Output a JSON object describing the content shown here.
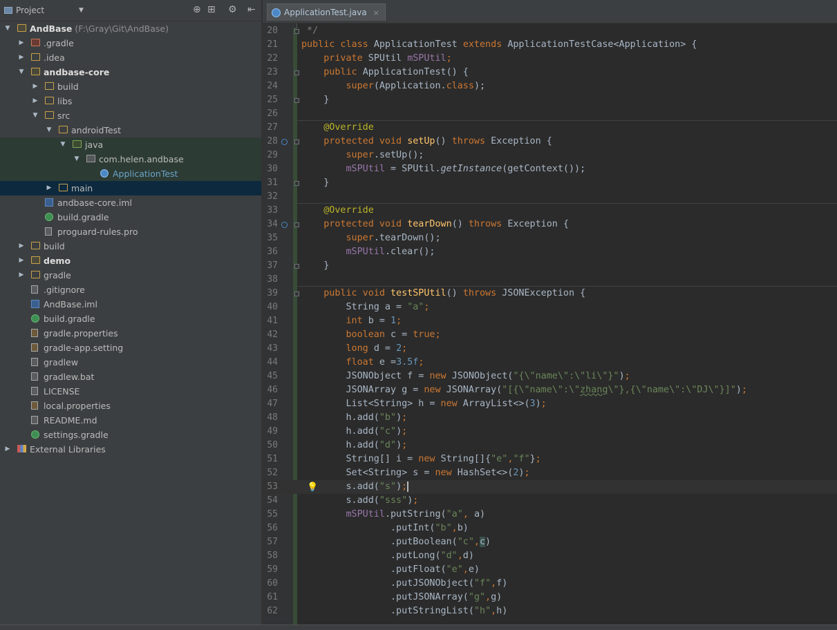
{
  "project_panel": {
    "title": "Project",
    "tree": [
      {
        "label": "AndBase",
        "path": "(F:\\Gray\\Git\\AndBase)",
        "depth": 0,
        "arrow": "open",
        "icon": "module-folder-icon",
        "bold": true
      },
      {
        "label": ".gradle",
        "depth": 1,
        "arrow": "closed",
        "icon": "folder-excluded-icon"
      },
      {
        "label": ".idea",
        "depth": 1,
        "arrow": "closed",
        "icon": "folder-icon"
      },
      {
        "label": "andbase-core",
        "depth": 1,
        "arrow": "open",
        "icon": "module-folder-icon",
        "bold": true
      },
      {
        "label": "build",
        "depth": 2,
        "arrow": "closed",
        "icon": "folder-icon"
      },
      {
        "label": "libs",
        "depth": 2,
        "arrow": "closed",
        "icon": "folder-icon"
      },
      {
        "label": "src",
        "depth": 2,
        "arrow": "open",
        "icon": "folder-icon"
      },
      {
        "label": "androidTest",
        "depth": 3,
        "arrow": "open",
        "icon": "folder-icon"
      },
      {
        "label": "java",
        "depth": 4,
        "arrow": "open",
        "icon": "test-source-folder-icon",
        "highlight": "soft"
      },
      {
        "label": "com.helen.andbase",
        "depth": 5,
        "arrow": "open",
        "icon": "package-icon",
        "highlight": "soft"
      },
      {
        "label": "ApplicationTest",
        "depth": 6,
        "arrow": "none",
        "icon": "java-class-icon",
        "teal": true,
        "highlight": "soft"
      },
      {
        "label": "main",
        "depth": 3,
        "arrow": "closed",
        "icon": "folder-icon",
        "highlight": "selected"
      },
      {
        "label": "andbase-core.iml",
        "depth": 2,
        "arrow": "none",
        "icon": "iml-file-icon"
      },
      {
        "label": "build.gradle",
        "depth": 2,
        "arrow": "none",
        "icon": "gradle-file-icon"
      },
      {
        "label": "proguard-rules.pro",
        "depth": 2,
        "arrow": "none",
        "icon": "file-icon"
      },
      {
        "label": "build",
        "depth": 1,
        "arrow": "closed",
        "icon": "folder-icon"
      },
      {
        "label": "demo",
        "depth": 1,
        "arrow": "closed",
        "icon": "module-folder-icon",
        "bold": true
      },
      {
        "label": "gradle",
        "depth": 1,
        "arrow": "closed",
        "icon": "folder-icon"
      },
      {
        "label": ".gitignore",
        "depth": 1,
        "arrow": "none",
        "icon": "file-icon"
      },
      {
        "label": "AndBase.iml",
        "depth": 1,
        "arrow": "none",
        "icon": "iml-file-icon"
      },
      {
        "label": "build.gradle",
        "depth": 1,
        "arrow": "none",
        "icon": "gradle-file-icon"
      },
      {
        "label": "gradle.properties",
        "depth": 1,
        "arrow": "none",
        "icon": "properties-file-icon"
      },
      {
        "label": "gradle-app.setting",
        "depth": 1,
        "arrow": "none",
        "icon": "properties-file-icon"
      },
      {
        "label": "gradlew",
        "depth": 1,
        "arrow": "none",
        "icon": "file-icon"
      },
      {
        "label": "gradlew.bat",
        "depth": 1,
        "arrow": "none",
        "icon": "file-icon"
      },
      {
        "label": "LICENSE",
        "depth": 1,
        "arrow": "none",
        "icon": "file-icon"
      },
      {
        "label": "local.properties",
        "depth": 1,
        "arrow": "none",
        "icon": "properties-file-icon"
      },
      {
        "label": "README.md",
        "depth": 1,
        "arrow": "none",
        "icon": "file-icon"
      },
      {
        "label": "settings.gradle",
        "depth": 1,
        "arrow": "none",
        "icon": "gradle-file-icon"
      },
      {
        "label": "External Libraries",
        "depth": 0,
        "arrow": "closed",
        "icon": "libraries-icon"
      }
    ]
  },
  "editor": {
    "tab": {
      "label": "ApplicationTest.java",
      "close": "×"
    },
    "lines": [
      {
        "n": "20",
        "t": [
          [
            "cm",
            " */"
          ]
        ]
      },
      {
        "n": "21",
        "t": [
          [
            "kw",
            "public class "
          ],
          [
            "",
            "ApplicationTest "
          ],
          [
            "kw",
            "extends "
          ],
          [
            "",
            "ApplicationTestCase<Application> {"
          ]
        ]
      },
      {
        "n": "22",
        "t": [
          [
            "",
            "    "
          ],
          [
            "kw",
            "private "
          ],
          [
            "",
            "SPUtil "
          ],
          [
            "fld",
            "mSPUtil"
          ],
          [
            "kw",
            ";"
          ]
        ]
      },
      {
        "n": "23",
        "t": [
          [
            "",
            "    "
          ],
          [
            "kw",
            "public "
          ],
          [
            "",
            "ApplicationTest() {"
          ]
        ]
      },
      {
        "n": "24",
        "t": [
          [
            "",
            "        "
          ],
          [
            "kw",
            "super"
          ],
          [
            "",
            "(Application."
          ],
          [
            "kw",
            "class"
          ],
          [
            "",
            ");"
          ]
        ]
      },
      {
        "n": "25",
        "t": [
          [
            "",
            "    }"
          ]
        ]
      },
      {
        "n": "26",
        "t": [
          [
            "",
            ""
          ]
        ]
      },
      {
        "n": "27",
        "t": [
          [
            "",
            "    "
          ],
          [
            "an",
            "@Override"
          ]
        ]
      },
      {
        "n": "28",
        "t": [
          [
            "",
            "    "
          ],
          [
            "kw",
            "protected void "
          ],
          [
            "fn",
            "setUp"
          ],
          [
            "",
            "() "
          ],
          [
            "kw",
            "throws "
          ],
          [
            "",
            "Exception {"
          ]
        ]
      },
      {
        "n": "29",
        "t": [
          [
            "",
            "        "
          ],
          [
            "kw",
            "super"
          ],
          [
            "",
            ".setUp();"
          ]
        ]
      },
      {
        "n": "30",
        "t": [
          [
            "",
            "        "
          ],
          [
            "fld",
            "mSPUtil"
          ],
          [
            "",
            " = SPUtil."
          ],
          [
            "it",
            "getInstance"
          ],
          [
            "",
            "(getContext());"
          ]
        ]
      },
      {
        "n": "31",
        "t": [
          [
            "",
            "    }"
          ]
        ]
      },
      {
        "n": "32",
        "t": [
          [
            "",
            ""
          ]
        ]
      },
      {
        "n": "33",
        "t": [
          [
            "",
            "    "
          ],
          [
            "an",
            "@Override"
          ]
        ]
      },
      {
        "n": "34",
        "t": [
          [
            "",
            "    "
          ],
          [
            "kw",
            "protected void "
          ],
          [
            "fn",
            "tearDown"
          ],
          [
            "",
            "() "
          ],
          [
            "kw",
            "throws "
          ],
          [
            "",
            "Exception {"
          ]
        ]
      },
      {
        "n": "35",
        "t": [
          [
            "",
            "        "
          ],
          [
            "kw",
            "super"
          ],
          [
            "",
            ".tearDown();"
          ]
        ]
      },
      {
        "n": "36",
        "t": [
          [
            "",
            "        "
          ],
          [
            "fld",
            "mSPUtil"
          ],
          [
            "",
            ".clear();"
          ]
        ]
      },
      {
        "n": "37",
        "t": [
          [
            "",
            "    }"
          ]
        ]
      },
      {
        "n": "38",
        "t": [
          [
            "",
            ""
          ]
        ]
      },
      {
        "n": "39",
        "t": [
          [
            "",
            "    "
          ],
          [
            "kw",
            "public void "
          ],
          [
            "fn",
            "testSPUtil"
          ],
          [
            "",
            "() "
          ],
          [
            "kw",
            "throws "
          ],
          [
            "",
            "JSONException {"
          ]
        ]
      },
      {
        "n": "40",
        "t": [
          [
            "",
            "        String a = "
          ],
          [
            "str",
            "\"a\""
          ],
          [
            "kw",
            ";"
          ]
        ]
      },
      {
        "n": "41",
        "t": [
          [
            "",
            "        "
          ],
          [
            "kw",
            "int "
          ],
          [
            "",
            "b = "
          ],
          [
            "nm",
            "1"
          ],
          [
            "kw",
            ";"
          ]
        ]
      },
      {
        "n": "42",
        "t": [
          [
            "",
            "        "
          ],
          [
            "kw",
            "boolean "
          ],
          [
            "",
            "c = "
          ],
          [
            "kw",
            "true;"
          ]
        ]
      },
      {
        "n": "43",
        "t": [
          [
            "",
            "        "
          ],
          [
            "kw",
            "long "
          ],
          [
            "",
            "d = "
          ],
          [
            "nm",
            "2"
          ],
          [
            "kw",
            ";"
          ]
        ]
      },
      {
        "n": "44",
        "t": [
          [
            "",
            "        "
          ],
          [
            "kw",
            "float "
          ],
          [
            "",
            "e ="
          ],
          [
            "nm",
            "3.5f"
          ],
          [
            "kw",
            ";"
          ]
        ]
      },
      {
        "n": "45",
        "t": [
          [
            "",
            "        JSONObject f = "
          ],
          [
            "kw",
            "new "
          ],
          [
            "",
            "JSONObject("
          ],
          [
            "str",
            "\"{\\\"name\\\":\\\"li\\\"}\""
          ],
          [
            "",
            ")"
          ],
          [
            "kw",
            ";"
          ]
        ]
      },
      {
        "n": "46",
        "t": [
          [
            "",
            "        JSONArray g = "
          ],
          [
            "kw",
            "new "
          ],
          [
            "",
            "JSONArray("
          ],
          [
            "str",
            "\"[{\\\"name\\\":\\\""
          ],
          [
            "zag",
            "zhang"
          ],
          [
            "str",
            "\\\"},{\\\"name\\\":\\\"DJ\\\"}]\""
          ],
          [
            "",
            ")"
          ],
          [
            "kw",
            ";"
          ]
        ]
      },
      {
        "n": "47",
        "t": [
          [
            "",
            "        List<String> h = "
          ],
          [
            "kw",
            "new "
          ],
          [
            "",
            "ArrayList<>("
          ],
          [
            "nm",
            "3"
          ],
          [
            "",
            ")"
          ],
          [
            "kw",
            ";"
          ]
        ]
      },
      {
        "n": "48",
        "t": [
          [
            "",
            "        h.add("
          ],
          [
            "str",
            "\"b\""
          ],
          [
            "",
            ")"
          ],
          [
            "kw",
            ";"
          ]
        ]
      },
      {
        "n": "49",
        "t": [
          [
            "",
            "        h.add("
          ],
          [
            "str",
            "\"c\""
          ],
          [
            "",
            ")"
          ],
          [
            "kw",
            ";"
          ]
        ]
      },
      {
        "n": "50",
        "t": [
          [
            "",
            "        h.add("
          ],
          [
            "str",
            "\"d\""
          ],
          [
            "",
            ")"
          ],
          [
            "kw",
            ";"
          ]
        ]
      },
      {
        "n": "51",
        "t": [
          [
            "",
            "        String[] i = "
          ],
          [
            "kw",
            "new "
          ],
          [
            "",
            "String[]{"
          ],
          [
            "str",
            "\"e\""
          ],
          [
            "kw",
            ","
          ],
          [
            "str",
            "\"f\""
          ],
          [
            "",
            "}"
          ],
          [
            "kw",
            ";"
          ]
        ]
      },
      {
        "n": "52",
        "t": [
          [
            "",
            "        Set<String> s = "
          ],
          [
            "kw",
            "new "
          ],
          [
            "",
            "HashSet<>("
          ],
          [
            "nm",
            "2"
          ],
          [
            "",
            ")"
          ],
          [
            "kw",
            ";"
          ]
        ]
      },
      {
        "n": "53",
        "t": [
          [
            "",
            "        s.add("
          ],
          [
            "str",
            "\"s\""
          ],
          [
            "",
            ")"
          ],
          [
            "kw",
            ";"
          ],
          [
            "caret",
            ""
          ]
        ],
        "current": true,
        "bulb": true
      },
      {
        "n": "54",
        "t": [
          [
            "",
            "        s.add("
          ],
          [
            "str",
            "\"sss\""
          ],
          [
            "",
            ")"
          ],
          [
            "kw",
            ";"
          ]
        ]
      },
      {
        "n": "55",
        "t": [
          [
            "",
            "        "
          ],
          [
            "fld",
            "mSPUtil"
          ],
          [
            "",
            ".putString("
          ],
          [
            "str",
            "\"a\""
          ],
          [
            "kw",
            ", "
          ],
          [
            "",
            "a)"
          ]
        ]
      },
      {
        "n": "56",
        "t": [
          [
            "",
            "                .putInt("
          ],
          [
            "str",
            "\"b\""
          ],
          [
            "kw",
            ","
          ],
          [
            "",
            "b)"
          ]
        ]
      },
      {
        "n": "57",
        "t": [
          [
            "",
            "                .putBoolean("
          ],
          [
            "str",
            "\"c\""
          ],
          [
            "kw",
            ","
          ],
          [
            "hl",
            "c"
          ],
          [
            "",
            ")"
          ]
        ]
      },
      {
        "n": "58",
        "t": [
          [
            "",
            "                .putLong("
          ],
          [
            "str",
            "\"d\""
          ],
          [
            "kw",
            ","
          ],
          [
            "",
            "d)"
          ]
        ]
      },
      {
        "n": "59",
        "t": [
          [
            "",
            "                .putFloat("
          ],
          [
            "str",
            "\"e\""
          ],
          [
            "kw",
            ","
          ],
          [
            "",
            "e)"
          ]
        ]
      },
      {
        "n": "60",
        "t": [
          [
            "",
            "                .putJSONObject("
          ],
          [
            "str",
            "\"f\""
          ],
          [
            "kw",
            ","
          ],
          [
            "",
            "f)"
          ]
        ]
      },
      {
        "n": "61",
        "t": [
          [
            "",
            "                .putJSONArray("
          ],
          [
            "str",
            "\"g\""
          ],
          [
            "kw",
            ","
          ],
          [
            "",
            "g)"
          ]
        ]
      },
      {
        "n": "62",
        "t": [
          [
            "",
            "                .putStringList("
          ],
          [
            "str",
            "\"h\""
          ],
          [
            "kw",
            ","
          ],
          [
            "",
            "h)"
          ]
        ]
      }
    ]
  },
  "icons": {
    "gear": "⚙",
    "collapse": "⇤",
    "locate": "⊕",
    "split": "⊞",
    "bulb": "💡",
    "arrow_open": "▼",
    "arrow_closed": "▶"
  }
}
